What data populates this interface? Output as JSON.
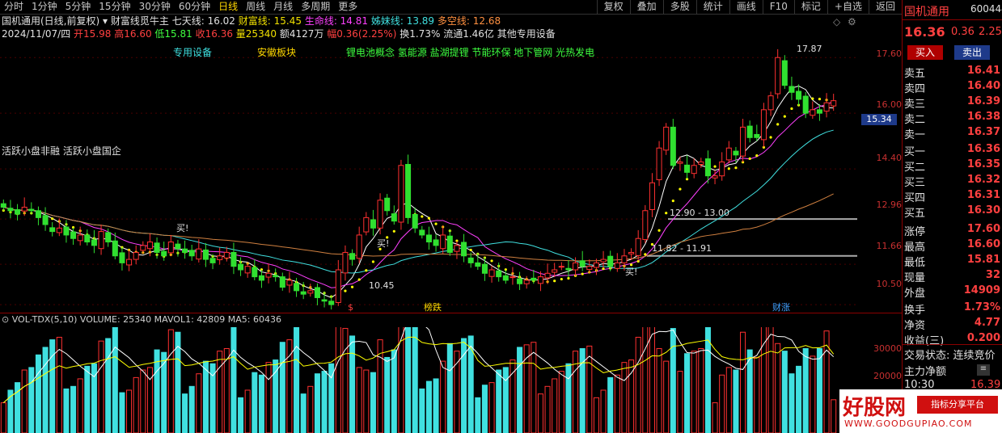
{
  "periods": [
    "分时",
    "1分钟",
    "5分钟",
    "15分钟",
    "30分钟",
    "60分钟",
    "日线",
    "周线",
    "月线",
    "多周期",
    "更多"
  ],
  "active_period": "日线",
  "tools": [
    "复权",
    "叠加",
    "多股",
    "统计",
    "画线",
    "F10",
    "标记",
    "+自选",
    "返回"
  ],
  "header": {
    "stock_line": "国机通用(日线,前复权)",
    "indicator_name": "财富线觅牛主",
    "qixian": "七天线: 16.02",
    "caifu": "财富线: 15.45",
    "shengming": "生命线: 14.81",
    "meimei": "姊妹线: 13.89",
    "duokong": "多空线: 12.68",
    "date": "2024/11/07/四",
    "open": "开15.98",
    "high": "高16.60",
    "low": "低15.81",
    "close": "收16.36",
    "volume": "量25340",
    "amount": "额4127万",
    "change": "幅0.36(2.25%)",
    "turnover": "换1.73%",
    "float_cap": "流通1.46亿",
    "sector": "其他专用设备"
  },
  "concepts": {
    "c1": "专用设备",
    "c2": "安徽板块",
    "c3": "锂电池概念 氢能源 盐湖提锂 节能环保 地下管网 光热发电",
    "c4": "活跃小盘非融 活跃小盘国企"
  },
  "annotations": {
    "high_mark": "17.87",
    "low_mark": "10.45",
    "buy1": "买!",
    "buy2": "买!",
    "buy3": "买!",
    "range1": "12.90 - 13.00",
    "range2": "11.82 - 11.91",
    "event1": "$",
    "event2": "榜跌",
    "event3": "财涨",
    "price_tag": "15.34"
  },
  "y_axis": [
    "17.60",
    "16.00",
    "14.40",
    "12.96",
    "11.66",
    "10.50"
  ],
  "vol_axis": [
    "30000",
    "20000"
  ],
  "vol_info": "VOL-TDX(5,10) VOLUME: 25340 MAVOL1: 42809 MA5: 60436",
  "right_panel": {
    "name": "国机通用",
    "code": "600444",
    "price": "16.36",
    "chg": "0.36",
    "pct": "2.25",
    "buy_btn": "买入",
    "sell_btn": "卖出",
    "sells": [
      [
        "卖五",
        "16.41"
      ],
      [
        "卖四",
        "16.40"
      ],
      [
        "卖三",
        "16.39"
      ],
      [
        "卖二",
        "16.38"
      ],
      [
        "卖一",
        "16.37"
      ]
    ],
    "buys": [
      [
        "买一",
        "16.36"
      ],
      [
        "买二",
        "16.35"
      ],
      [
        "买三",
        "16.32"
      ],
      [
        "买四",
        "16.31"
      ],
      [
        "买五",
        "16.30"
      ]
    ],
    "stats": [
      [
        "涨停",
        "17.60"
      ],
      [
        "最高",
        "16.60"
      ],
      [
        "最低",
        "15.81"
      ],
      [
        "现量",
        "32"
      ],
      [
        "外盘",
        "14909"
      ],
      [
        "换手",
        "1.73%"
      ],
      [
        "净资",
        "4.77"
      ],
      [
        "收益(三)",
        "0.200"
      ]
    ],
    "trade_status": "交易状态: 连续竞价",
    "main_net": "主力净额",
    "time": "10:30",
    "time_price": "16.39"
  },
  "watermark": {
    "big": "好股网",
    "small": "指标分享平台",
    "url": "WWW.GOODGUPIAO.COM"
  },
  "chart_data": {
    "type": "candlestick",
    "ylim": [
      10.2,
      18.0
    ],
    "closes": [
      13.3,
      13.2,
      13.1,
      13.3,
      13.2,
      13.0,
      12.8,
      12.6,
      12.7,
      12.5,
      12.4,
      12.5,
      12.3,
      12.2,
      12.6,
      12.3,
      11.9,
      11.7,
      11.8,
      12.0,
      12.2,
      12.3,
      12.0,
      11.9,
      12.3,
      12.1,
      12.0,
      11.9,
      12.1,
      11.8,
      11.7,
      11.9,
      12.0,
      11.6,
      11.5,
      11.6,
      11.3,
      11.2,
      11.4,
      11.3,
      11.0,
      11.2,
      10.9,
      10.8,
      10.9,
      10.7,
      10.6,
      10.5,
      11.5,
      12.0,
      11.8,
      12.5,
      13.0,
      12.7,
      13.5,
      13.2,
      12.9,
      14.5,
      13.0,
      12.7,
      12.5,
      12.3,
      12.2,
      12.5,
      12.0,
      12.2,
      11.9,
      11.7,
      11.6,
      11.4,
      11.5,
      11.3,
      11.2,
      11.3,
      11.1,
      11.2,
      11.2,
      11.3,
      11.4,
      11.5,
      11.6,
      11.5,
      11.7,
      11.6,
      11.6,
      11.7,
      11.8,
      11.6,
      11.7,
      11.9,
      12.0,
      12.4,
      13.2,
      14.0,
      15.0,
      15.6,
      14.5,
      14.6,
      14.3,
      14.5,
      14.6,
      14.2,
      14.2,
      14.6,
      15.0,
      14.8,
      15.6,
      15.3,
      15.3,
      16.1,
      16.5,
      17.6,
      16.8,
      16.6,
      16.4,
      16.0,
      16.1,
      16.0,
      16.3,
      16.36
    ]
  }
}
